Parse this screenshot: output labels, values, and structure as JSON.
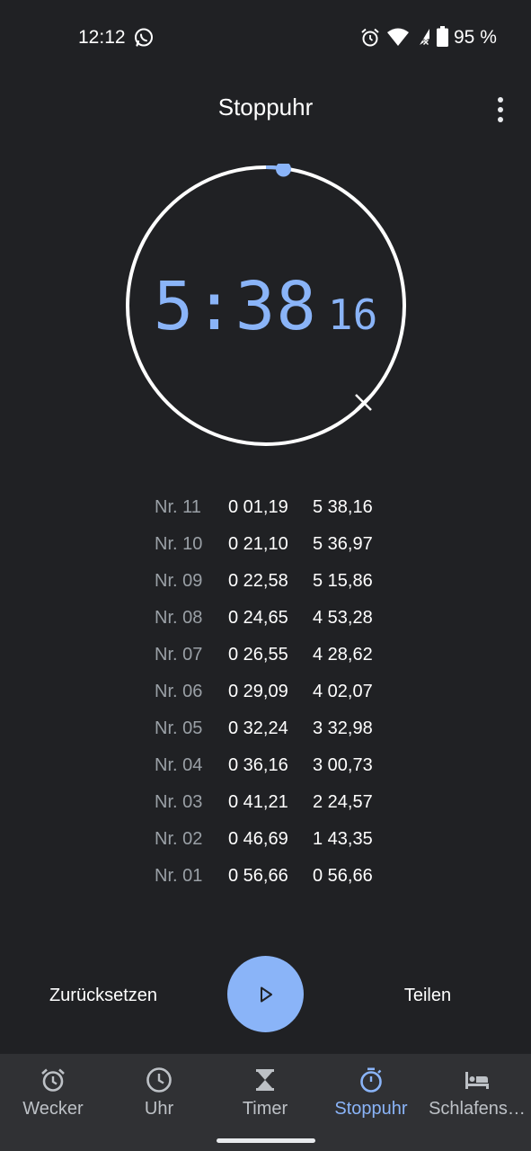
{
  "status_bar": {
    "time": "12:12",
    "battery": "95 %"
  },
  "header": {
    "title": "Stoppuhr"
  },
  "stopwatch": {
    "minutes_seconds": "5:38",
    "hundredths": "16"
  },
  "laps": [
    {
      "number": "Nr. 11",
      "lap": "0 01,19",
      "total": "5 38,16"
    },
    {
      "number": "Nr. 10",
      "lap": "0 21,10",
      "total": "5 36,97"
    },
    {
      "number": "Nr. 09",
      "lap": "0 22,58",
      "total": "5 15,86"
    },
    {
      "number": "Nr. 08",
      "lap": "0 24,65",
      "total": "4 53,28"
    },
    {
      "number": "Nr. 07",
      "lap": "0 26,55",
      "total": "4 28,62"
    },
    {
      "number": "Nr. 06",
      "lap": "0 29,09",
      "total": "4 02,07"
    },
    {
      "number": "Nr. 05",
      "lap": "0 32,24",
      "total": "3 32,98"
    },
    {
      "number": "Nr. 04",
      "lap": "0 36,16",
      "total": "3 00,73"
    },
    {
      "number": "Nr. 03",
      "lap": "0 41,21",
      "total": "2 24,57"
    },
    {
      "number": "Nr. 02",
      "lap": "0 46,69",
      "total": "1 43,35"
    },
    {
      "number": "Nr. 01",
      "lap": "0 56,66",
      "total": "0 56,66"
    }
  ],
  "actions": {
    "reset_label": "Zurücksetzen",
    "share_label": "Teilen",
    "play_icon": "play-icon"
  },
  "nav": {
    "items": [
      {
        "label": "Wecker",
        "icon": "alarm-icon"
      },
      {
        "label": "Uhr",
        "icon": "clock-icon"
      },
      {
        "label": "Timer",
        "icon": "hourglass-icon"
      },
      {
        "label": "Stoppuhr",
        "icon": "stopwatch-icon",
        "active": true
      },
      {
        "label": "Schlafens…",
        "icon": "bed-icon"
      }
    ]
  },
  "colors": {
    "background": "#202124",
    "accent": "#8ab4f8",
    "nav_background": "#303134"
  }
}
